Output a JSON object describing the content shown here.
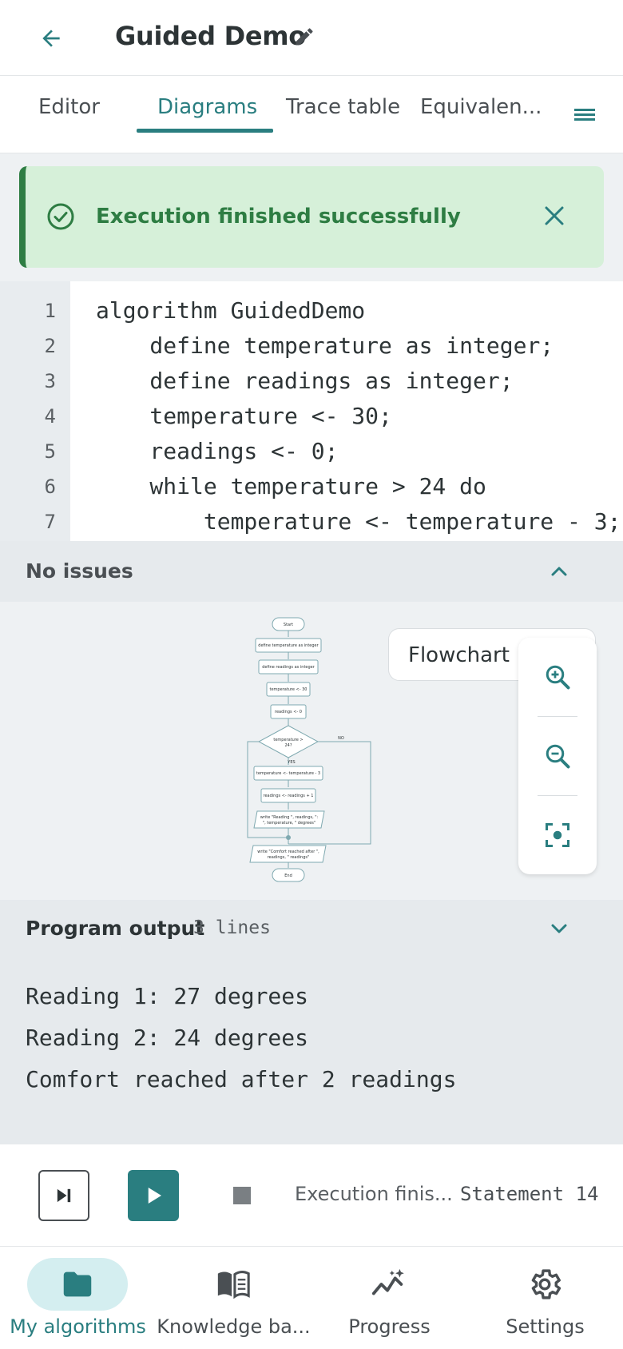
{
  "header": {
    "title": "Guided Demo"
  },
  "tabs": [
    {
      "label": "Editor",
      "active": false
    },
    {
      "label": "Diagrams",
      "active": true
    },
    {
      "label": "Trace table",
      "active": false
    },
    {
      "label": "Equivalen...",
      "active": false
    }
  ],
  "banner": {
    "message": "Execution finished successfully",
    "color": "#2e7d43"
  },
  "editor": {
    "lines": [
      {
        "num": "1",
        "code": "algorithm GuidedDemo"
      },
      {
        "num": "2",
        "code": "    define temperature as integer;"
      },
      {
        "num": "3",
        "code": "    define readings as integer;"
      },
      {
        "num": "4",
        "code": "    temperature <- 30;"
      },
      {
        "num": "5",
        "code": "    readings <- 0;"
      },
      {
        "num": "6",
        "code": "    while temperature > 24 do"
      },
      {
        "num": "7",
        "code": "        temperature <- temperature - 3;"
      }
    ]
  },
  "issues": {
    "label": "No issues"
  },
  "diagram": {
    "selector_label": "Flowchart",
    "nodes": {
      "start": "Start",
      "n1": "define temperature as integer",
      "n2": "define readings as integer",
      "n3": "temperature <- 30",
      "n4": "readings <- 0",
      "cond1": "temperature >",
      "cond2": "24?",
      "yes": "YES",
      "no": "NO",
      "n5": "temperature <- temperature - 3",
      "n6": "readings <- readings + 1",
      "w1a": "write \"Reading \", readings, \":",
      "w1b": "\", temperature, \" degrees\"",
      "w2a": "write \"Comfort reached after \",",
      "w2b": "readings, \" readings\"",
      "end": "End"
    },
    "zoom_in_icon": "zoom-in-icon",
    "zoom_out_icon": "zoom-out-icon",
    "fit_icon": "fit-screen-icon"
  },
  "output": {
    "title": "Program output",
    "count": "3 lines",
    "lines": [
      "Reading 1: 27 degrees",
      "Reading 2: 24 degrees",
      "Comfort reached after 2 readings"
    ]
  },
  "controls": {
    "status": "Execution finis...",
    "statement": "Statement 14"
  },
  "nav": [
    {
      "label": "My algorithms",
      "icon": "folder-icon",
      "active": true
    },
    {
      "label": "Knowledge ba...",
      "icon": "book-icon",
      "active": false
    },
    {
      "label": "Progress",
      "icon": "progress-icon",
      "active": false
    },
    {
      "label": "Settings",
      "icon": "gear-icon",
      "active": false
    }
  ],
  "colors": {
    "accent": "#2a7e80",
    "success": "#2e7d43",
    "success_bg": "#d6f0d9"
  }
}
